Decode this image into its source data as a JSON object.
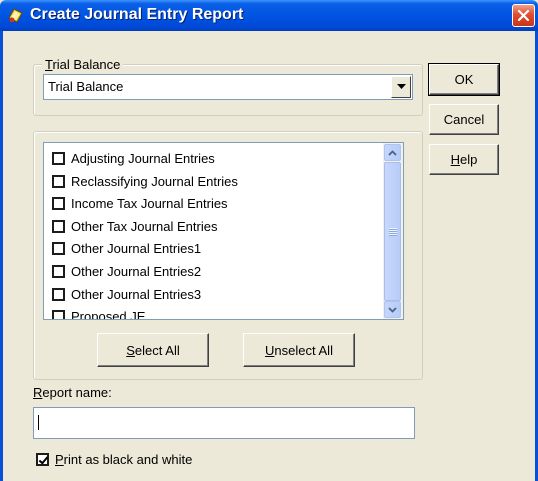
{
  "window": {
    "title": "Create Journal Entry Report",
    "icon": "app-icon"
  },
  "trial_balance": {
    "legend_hotkey": "T",
    "legend_rest": "rial Balance",
    "selected": "Trial Balance"
  },
  "buttons": {
    "ok": "OK",
    "cancel": "Cancel",
    "help_hotkey": "H",
    "help_rest": "elp"
  },
  "entries": [
    {
      "label": "Adjusting Journal Entries",
      "checked": false
    },
    {
      "label": "Reclassifying Journal Entries",
      "checked": false
    },
    {
      "label": "Income Tax Journal Entries",
      "checked": false
    },
    {
      "label": "Other Tax Journal Entries",
      "checked": false
    },
    {
      "label": "Other Journal Entries1",
      "checked": false
    },
    {
      "label": "Other Journal Entries2",
      "checked": false
    },
    {
      "label": "Other Journal Entries3",
      "checked": false
    },
    {
      "label": "Proposed JE",
      "checked": false
    }
  ],
  "select_all": {
    "hotkey": "S",
    "rest": "elect All"
  },
  "unselect_all": {
    "hotkey": "U",
    "rest": "nselect All"
  },
  "report_name": {
    "label_hotkey": "R",
    "label_rest": "eport name:",
    "value": ""
  },
  "print_bw": {
    "hotkey": "P",
    "rest": "rint as black and white",
    "checked": true
  },
  "colors": {
    "title_bar": "#0054e3",
    "face": "#ece9d8",
    "close": "#e04d2f"
  }
}
